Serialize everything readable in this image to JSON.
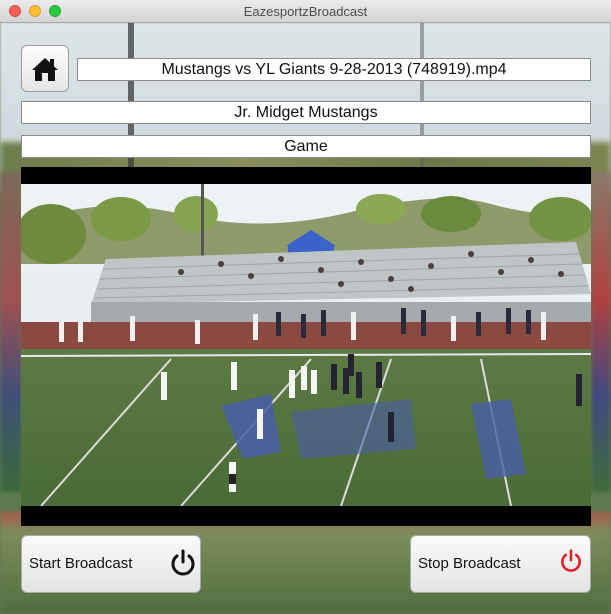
{
  "window": {
    "title": "EazesportzBroadcast"
  },
  "header": {
    "file_name": "Mustangs vs YL Giants 9-28-2013 (748919).mp4",
    "team_name": "Jr. Midget Mustangs",
    "event_type": "Game"
  },
  "video": {
    "content": "football-field-video-frame"
  },
  "controls": {
    "start_label": "Start Broadcast",
    "stop_label": "Stop Broadcast",
    "start_icon": "power-icon",
    "stop_icon": "power-icon",
    "stop_icon_color": "#e0202a",
    "start_icon_color": "#111111"
  },
  "icons": {
    "home": "home-icon"
  }
}
